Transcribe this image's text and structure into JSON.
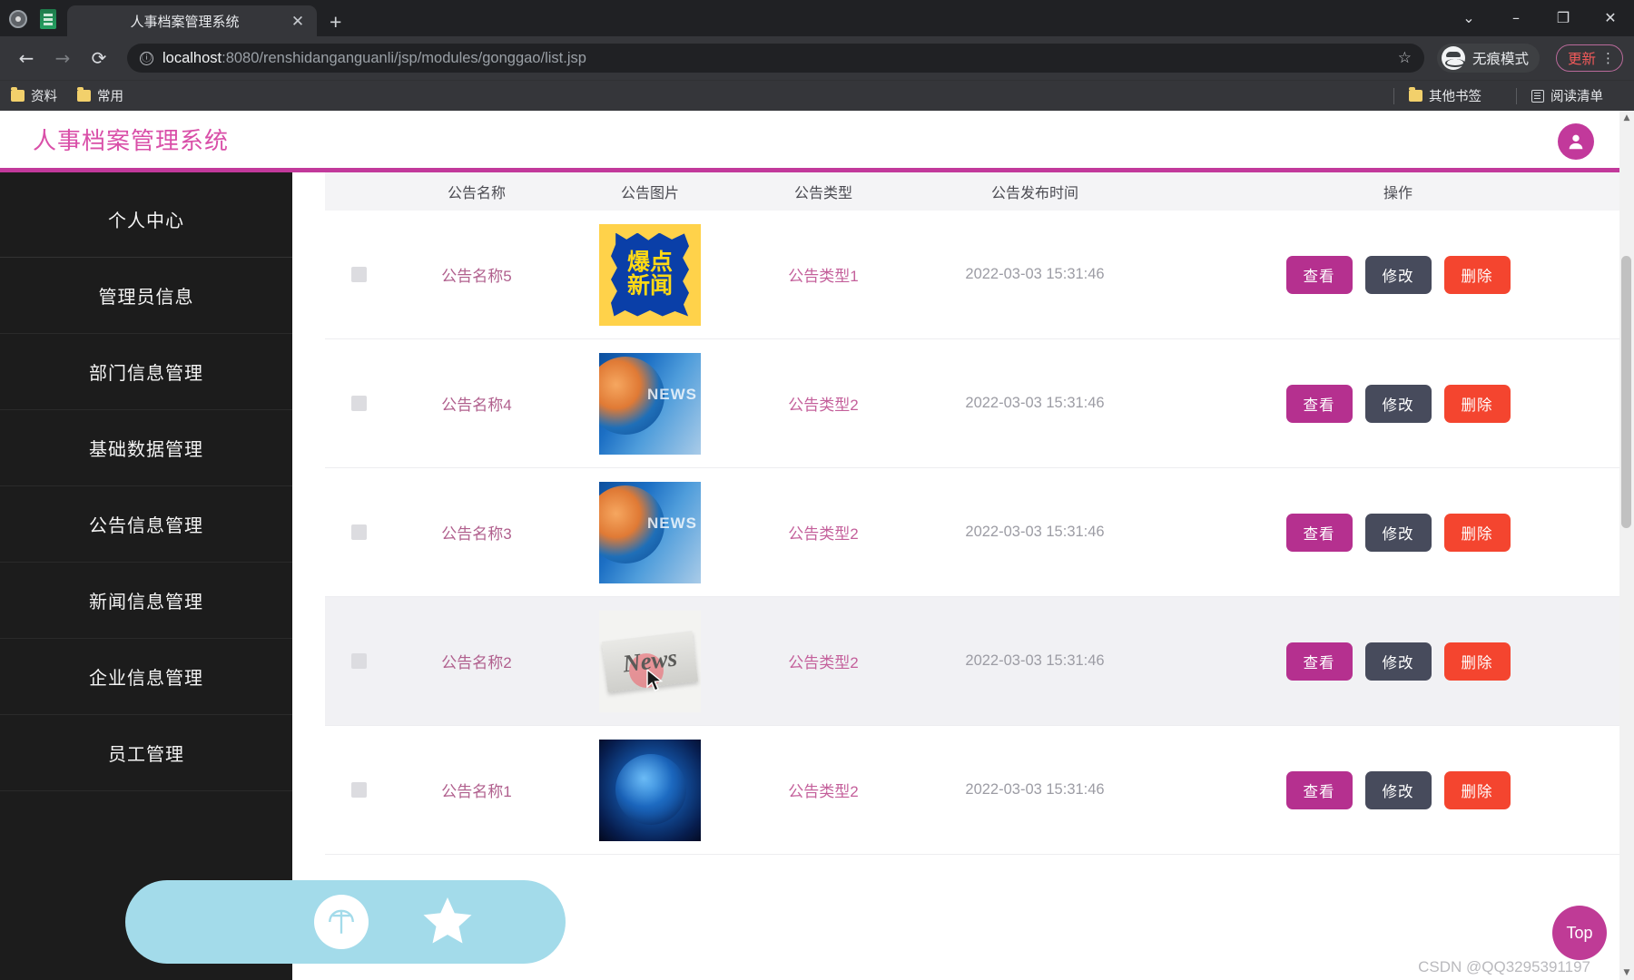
{
  "browser": {
    "tab": {
      "title": "人事档案管理系统",
      "close_label": "✕"
    },
    "new_tab_label": "+",
    "window_controls": {
      "dropdown": "⌄",
      "minimize": "–",
      "maximize": "❐",
      "close": "✕"
    },
    "nav": {
      "back": "←",
      "forward": "→",
      "reload": "⟳"
    },
    "url": {
      "info_icon": "ⓘ",
      "host": "localhost",
      "path": ":8080/renshidanganguanli/jsp/modules/gonggao/list.jsp",
      "star_icon": "☆"
    },
    "incognito_label": "无痕模式",
    "update_label": "更新",
    "kebab_label": "⋮",
    "bookmarks": [
      {
        "label": "资料",
        "icon": "folder-icon"
      },
      {
        "label": "常用",
        "icon": "folder-icon"
      }
    ],
    "bookmarks_right": [
      {
        "label": "其他书签",
        "icon": "folder-icon"
      },
      {
        "label": "阅读清单",
        "icon": "reading-list-icon"
      }
    ]
  },
  "app": {
    "title": "人事档案管理系统",
    "accent": "#c2399b",
    "link_color": "#b05f8d",
    "avatar_icon": "user-icon"
  },
  "sidebar": {
    "items": [
      {
        "label": "个人中心"
      },
      {
        "label": "管理员信息"
      },
      {
        "label": "部门信息管理"
      },
      {
        "label": "基础数据管理"
      },
      {
        "label": "公告信息管理"
      },
      {
        "label": "新闻信息管理"
      },
      {
        "label": "企业信息管理"
      },
      {
        "label": "员工管理"
      }
    ]
  },
  "table": {
    "columns": [
      {
        "key": "check",
        "label": ""
      },
      {
        "key": "name",
        "label": "公告名称"
      },
      {
        "key": "image",
        "label": "公告图片"
      },
      {
        "key": "type",
        "label": "公告类型"
      },
      {
        "key": "time",
        "label": "公告发布时间"
      },
      {
        "key": "ops",
        "label": "操作"
      }
    ],
    "buttons": {
      "view": "查看",
      "edit": "修改",
      "delete": "删除"
    },
    "button_colors": {
      "view": "#b5308f",
      "edit": "#474b5c",
      "delete": "#f4452f"
    },
    "rows": [
      {
        "name": "公告名称5",
        "image": "baodian-xinwen-thumbnail",
        "image_text_top": "爆点",
        "image_text_bottom": "新闻",
        "type": "公告类型1",
        "time": "2022-03-03 15:31:46",
        "hovered": false
      },
      {
        "name": "公告名称4",
        "image": "news-broadcast-thumbnail",
        "image_text_top": "",
        "image_text_bottom": "",
        "type": "公告类型2",
        "time": "2022-03-03 15:31:46",
        "hovered": false
      },
      {
        "name": "公告名称3",
        "image": "news-broadcast-thumbnail",
        "image_text_top": "",
        "image_text_bottom": "",
        "type": "公告类型2",
        "time": "2022-03-03 15:31:46",
        "hovered": false
      },
      {
        "name": "公告名称2",
        "image": "newspaper-thumbnail",
        "image_text_top": "News",
        "image_text_bottom": "",
        "type": "公告类型2",
        "time": "2022-03-03 15:31:46",
        "hovered": true
      },
      {
        "name": "公告名称1",
        "image": "globe-thumbnail",
        "image_text_top": "",
        "image_text_bottom": "",
        "type": "公告类型2",
        "time": "2022-03-03 15:31:46",
        "hovered": false
      }
    ]
  },
  "overlay": {
    "pill_color": "#a3dbea",
    "icons": [
      "umbrella-icon",
      "star-icon"
    ]
  },
  "top_button": {
    "label": "Top",
    "color": "#bf3b96"
  },
  "watermark": "CSDN @QQ3295391197",
  "scrollbar": {
    "up_arrow": "▲",
    "down_arrow": "▼"
  }
}
